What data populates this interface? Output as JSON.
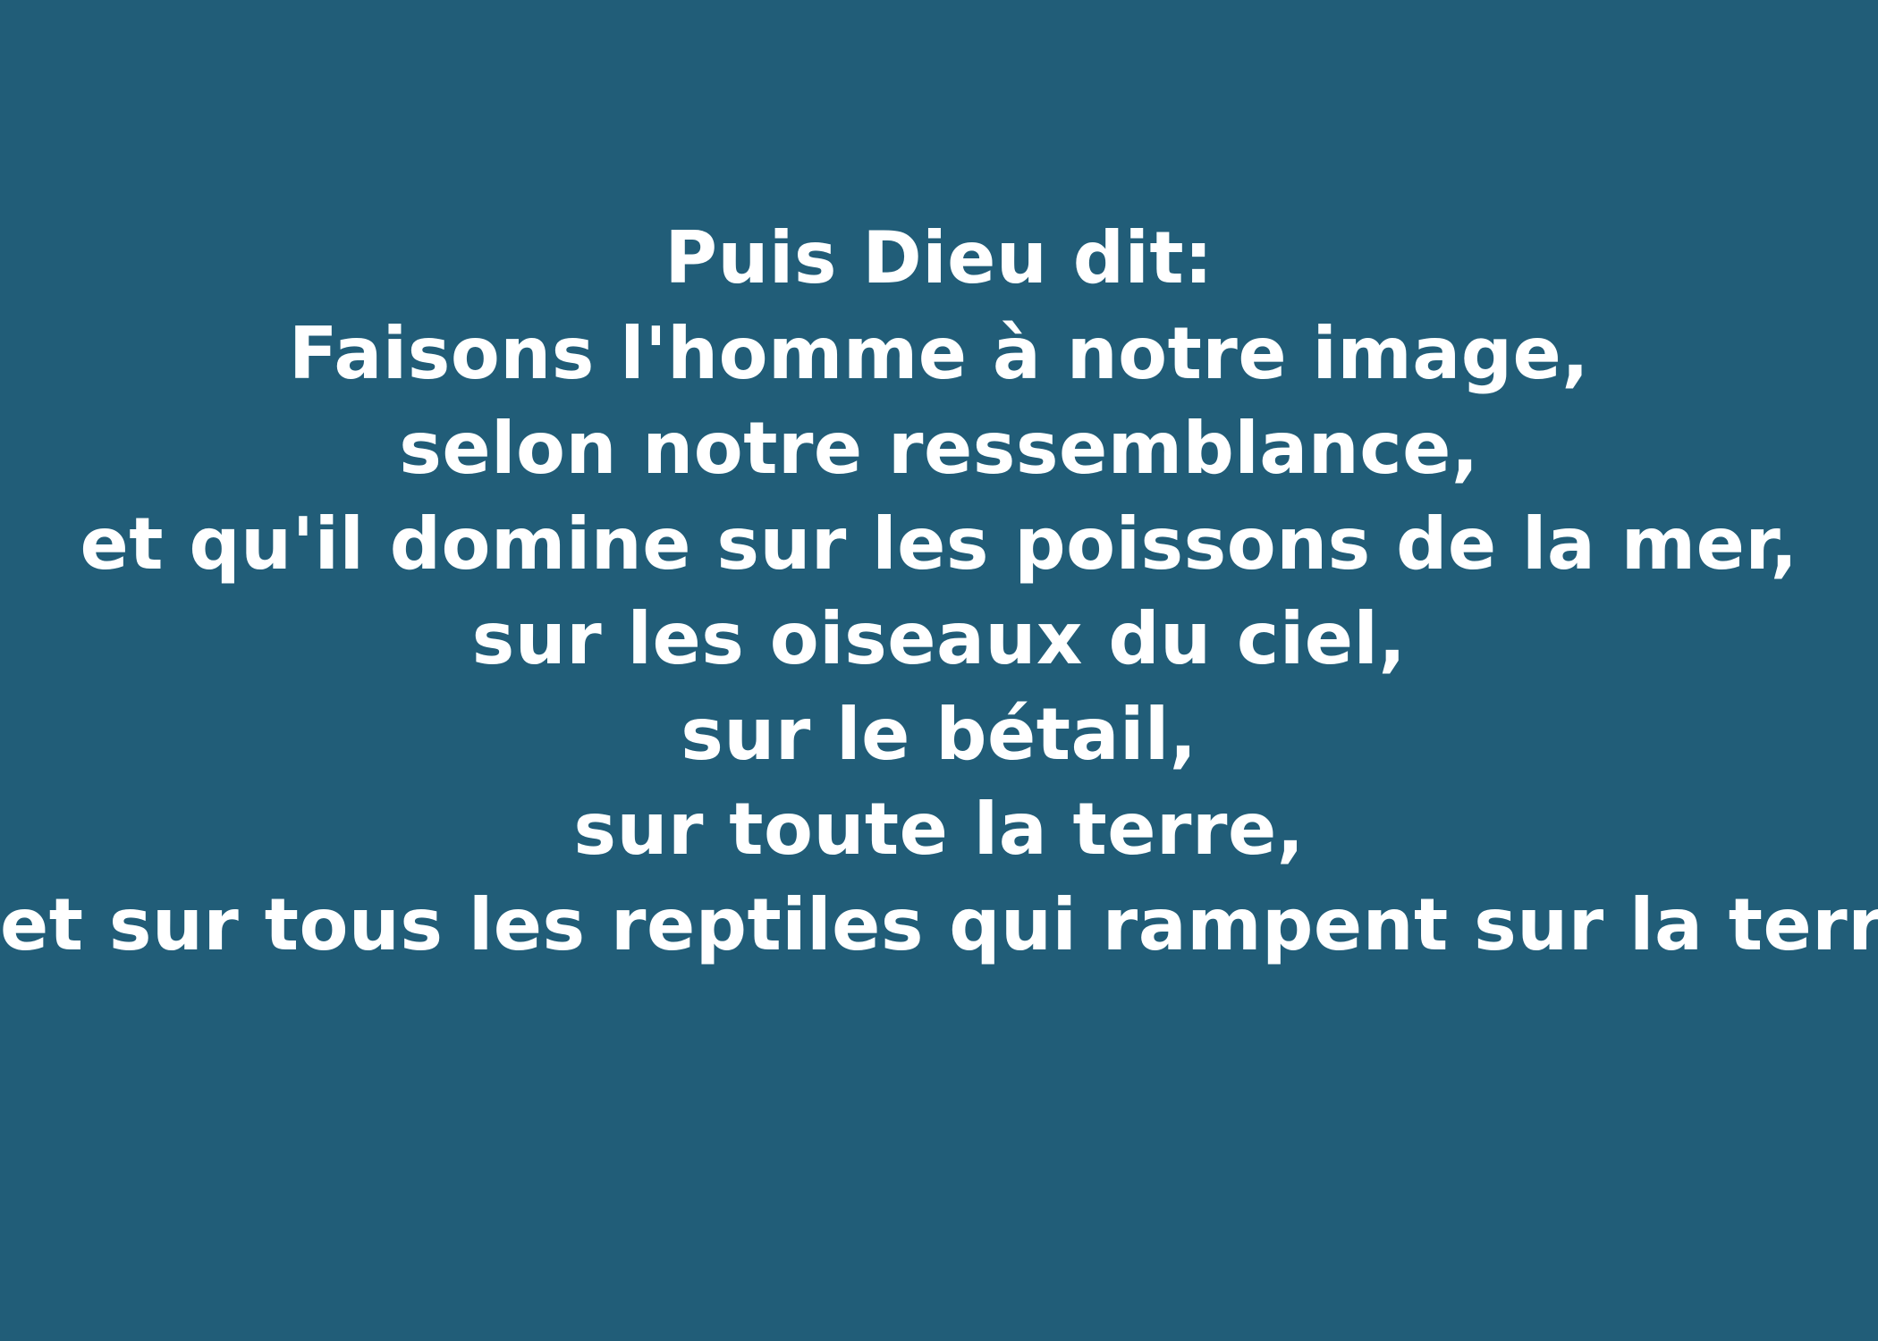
{
  "background_color": "#215d78",
  "text_color": "#ffffff",
  "verse": {
    "lines": [
      "Puis Dieu dit:",
      "Faisons l'homme à notre image,",
      "selon notre ressemblance,",
      "et qu'il domine sur les poissons de la mer,",
      "sur les oiseaux du ciel,",
      "sur le bétail,",
      "sur toute la terre,",
      "et sur tous les reptiles qui rampent sur la terre"
    ]
  }
}
